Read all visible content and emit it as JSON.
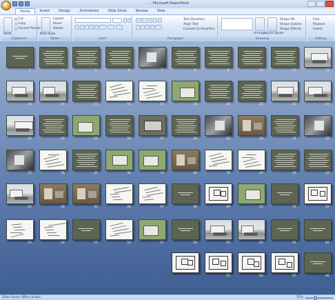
{
  "window": {
    "title": "… - Microsoft PowerPoint",
    "controls": [
      "minimize",
      "maximize",
      "close"
    ]
  },
  "tabs": [
    {
      "label": "Home",
      "active": true
    },
    {
      "label": "Insert"
    },
    {
      "label": "Design"
    },
    {
      "label": "Animations"
    },
    {
      "label": "Slide Show"
    },
    {
      "label": "Review"
    },
    {
      "label": "View"
    }
  ],
  "ribbon": {
    "groups": [
      {
        "label": "Clipboard",
        "buttons": [
          "Paste",
          "Cut",
          "Copy",
          "Format Painter"
        ]
      },
      {
        "label": "Slides",
        "buttons": [
          "New Slide",
          "Layout",
          "Reset",
          "Delete"
        ]
      },
      {
        "label": "Font",
        "buttons": [
          "Bold",
          "Italic",
          "Underline",
          "Shadow",
          "Strikethrough"
        ]
      },
      {
        "label": "Paragraph",
        "buttons": [
          "Text Direction",
          "Align Text",
          "Convert to SmartArt"
        ]
      },
      {
        "label": "Drawing",
        "buttons": [
          "Arrange",
          "Quick Styles",
          "Shape Fill",
          "Shape Outline",
          "Shape Effects"
        ]
      },
      {
        "label": "Editing",
        "buttons": [
          "Find",
          "Replace",
          "Select"
        ]
      }
    ]
  },
  "slides": [
    {
      "n": "12",
      "kind": "photo"
    },
    {
      "n": "11",
      "kind": "text"
    },
    {
      "n": "10",
      "kind": "text"
    },
    {
      "n": "9",
      "kind": "text"
    },
    {
      "n": "8",
      "kind": "text"
    },
    {
      "n": "7",
      "kind": "dark"
    },
    {
      "n": "6",
      "kind": "text"
    },
    {
      "n": "5",
      "kind": "text"
    },
    {
      "n": "4",
      "kind": "text"
    },
    {
      "n": "3",
      "kind": "title"
    },
    {
      "n": "22",
      "kind": "photo"
    },
    {
      "n": "21",
      "kind": "photo"
    },
    {
      "n": "20",
      "kind": "text"
    },
    {
      "n": "19",
      "kind": "text"
    },
    {
      "n": "18",
      "kind": "green"
    },
    {
      "n": "17",
      "kind": "sketch"
    },
    {
      "n": "16",
      "kind": "sketch"
    },
    {
      "n": "15",
      "kind": "text"
    },
    {
      "n": "14",
      "kind": "photo"
    },
    {
      "n": "13",
      "kind": "photo"
    },
    {
      "n": "32",
      "kind": "dark"
    },
    {
      "n": "31",
      "kind": "text"
    },
    {
      "n": "30",
      "kind": "brown"
    },
    {
      "n": "29",
      "kind": "dark"
    },
    {
      "n": "28",
      "kind": "text"
    },
    {
      "n": "27",
      "kind": "diagram"
    },
    {
      "n": "26",
      "kind": "text"
    },
    {
      "n": "25",
      "kind": "green"
    },
    {
      "n": "24",
      "kind": "text"
    },
    {
      "n": "23",
      "kind": "photo"
    },
    {
      "n": "42",
      "kind": "text"
    },
    {
      "n": "41",
      "kind": "text"
    },
    {
      "n": "40",
      "kind": "sketch"
    },
    {
      "n": "39",
      "kind": "sketch"
    },
    {
      "n": "38",
      "kind": "brown"
    },
    {
      "n": "37",
      "kind": "green"
    },
    {
      "n": "36",
      "kind": "green"
    },
    {
      "n": "35",
      "kind": "text"
    },
    {
      "n": "34",
      "kind": "sketch"
    },
    {
      "n": "33",
      "kind": "dark"
    },
    {
      "n": "52",
      "kind": "plan"
    },
    {
      "n": "51",
      "kind": "title"
    },
    {
      "n": "50",
      "kind": "green"
    },
    {
      "n": "49",
      "kind": "plan"
    },
    {
      "n": "48",
      "kind": "title"
    },
    {
      "n": "47",
      "kind": "sketch"
    },
    {
      "n": "46",
      "kind": "sketch"
    },
    {
      "n": "45",
      "kind": "brown"
    },
    {
      "n": "44",
      "kind": "brown"
    },
    {
      "n": "43",
      "kind": "photo"
    },
    {
      "n": "62",
      "kind": "title"
    },
    {
      "n": "61",
      "kind": "title"
    },
    {
      "n": "60",
      "kind": "photo"
    },
    {
      "n": "59",
      "kind": "photo"
    },
    {
      "n": "58",
      "kind": "title"
    },
    {
      "n": "57",
      "kind": "green"
    },
    {
      "n": "56",
      "kind": "sketch"
    },
    {
      "n": "55",
      "kind": "title"
    },
    {
      "n": "54",
      "kind": "sketch"
    },
    {
      "n": "53",
      "kind": "sketch"
    },
    {
      "n": "66",
      "kind": "title"
    },
    {
      "n": "65",
      "kind": "plan"
    },
    {
      "n": "64",
      "kind": "plan"
    },
    {
      "n": "63",
      "kind": "plan"
    },
    {
      "n": "",
      "kind": "plan"
    }
  ],
  "status": {
    "left": "Slide Sorter   Office   Arabic",
    "zoom": "55%"
  }
}
